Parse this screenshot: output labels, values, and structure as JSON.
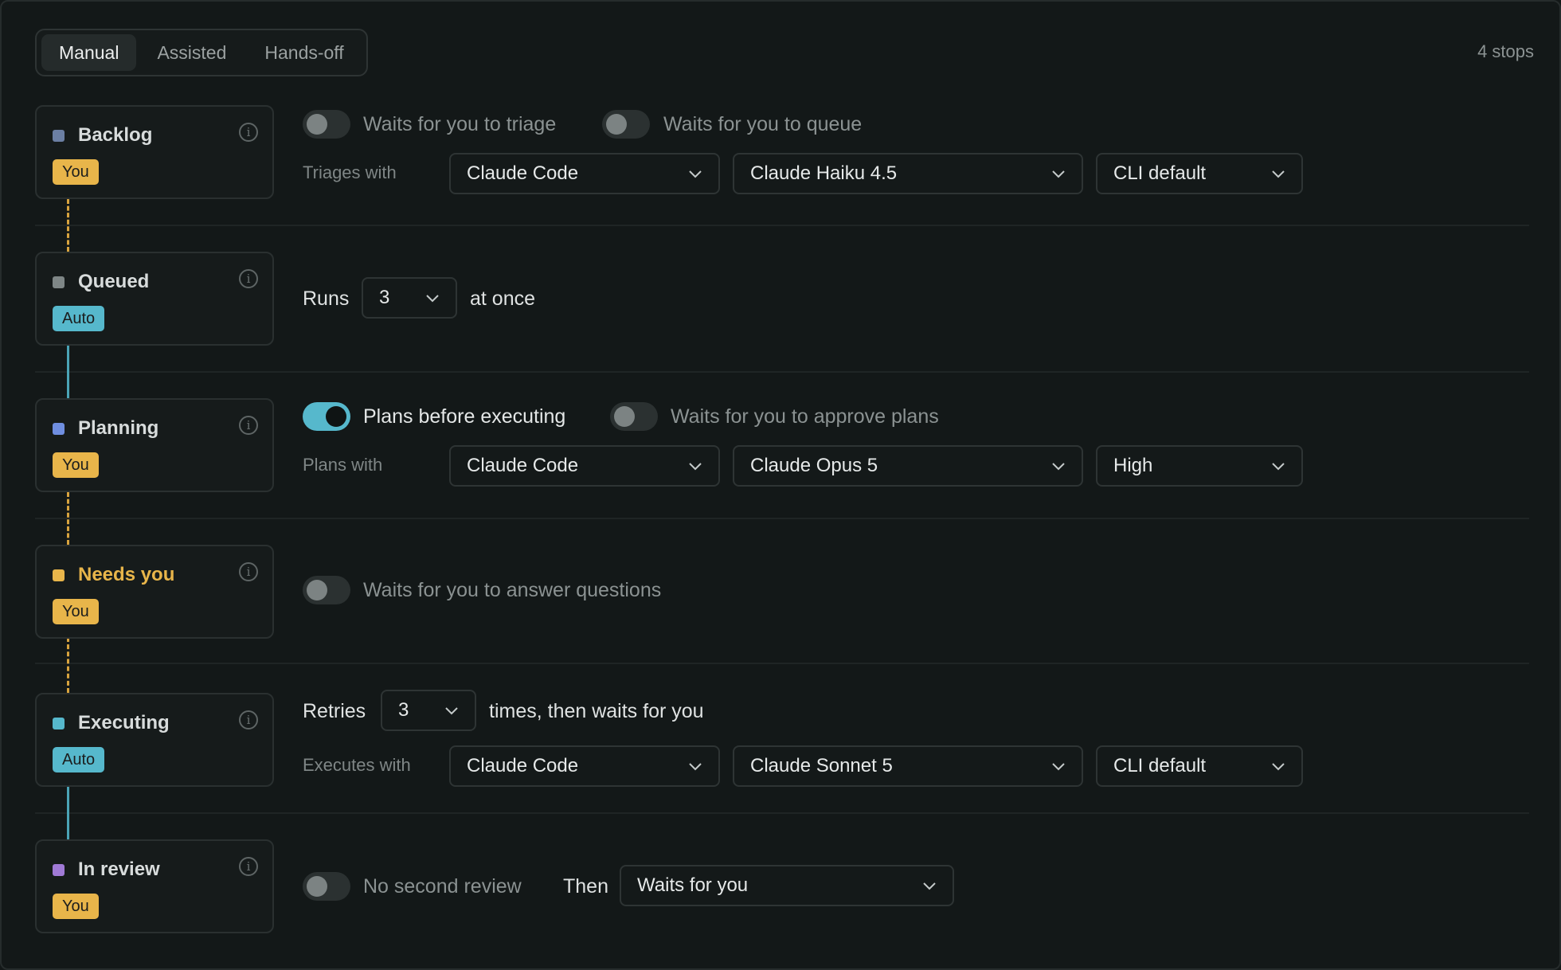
{
  "modes": {
    "tabs": [
      {
        "label": "Manual",
        "active": true
      },
      {
        "label": "Assisted",
        "active": false
      },
      {
        "label": "Hands-off",
        "active": false
      }
    ],
    "stops_count": "4 stops"
  },
  "colors": {
    "accent": "#56b8cc",
    "you_badge": "#e8b54a",
    "auto_badge": "#56b8cc",
    "needs_you_text": "#e8b54a"
  },
  "stages": [
    {
      "name": "Backlog",
      "badge": "You",
      "color": "#6b7fa3"
    },
    {
      "name": "Queued",
      "badge": "Auto",
      "color": "#7e8686"
    },
    {
      "name": "Planning",
      "badge": "You",
      "color": "#6f8ee0"
    },
    {
      "name": "Needs you",
      "badge": "You",
      "color": "#e8b54a"
    },
    {
      "name": "Executing",
      "badge": "Auto",
      "color": "#56b8cc"
    },
    {
      "name": "In review",
      "badge": "You",
      "color": "#a07ad6"
    }
  ],
  "backlog": {
    "toggle_triage": {
      "label": "Waits for you to triage",
      "on": false
    },
    "toggle_queue": {
      "label": "Waits for you to queue",
      "on": false
    },
    "label": "Triages with",
    "tool": "Claude Code",
    "model": "Claude Haiku 4.5",
    "effort": "CLI default"
  },
  "queued": {
    "prefix": "Runs",
    "count": "3",
    "suffix": "at once"
  },
  "planning": {
    "toggle_plans": {
      "label": "Plans before executing",
      "on": true
    },
    "toggle_approve": {
      "label": "Waits for you to approve plans",
      "on": false
    },
    "label": "Plans with",
    "tool": "Claude Code",
    "model": "Claude Opus 5",
    "effort": "High"
  },
  "needs_you": {
    "toggle_questions": {
      "label": "Waits for you to answer questions",
      "on": false
    }
  },
  "executing": {
    "prefix": "Retries",
    "count": "3",
    "suffix": "times, then waits for you",
    "label": "Executes with",
    "tool": "Claude Code",
    "model": "Claude Sonnet 5",
    "effort": "CLI default"
  },
  "in_review": {
    "toggle_review": {
      "label": "No second review",
      "on": false
    },
    "then_label": "Then",
    "then_value": "Waits for you"
  }
}
